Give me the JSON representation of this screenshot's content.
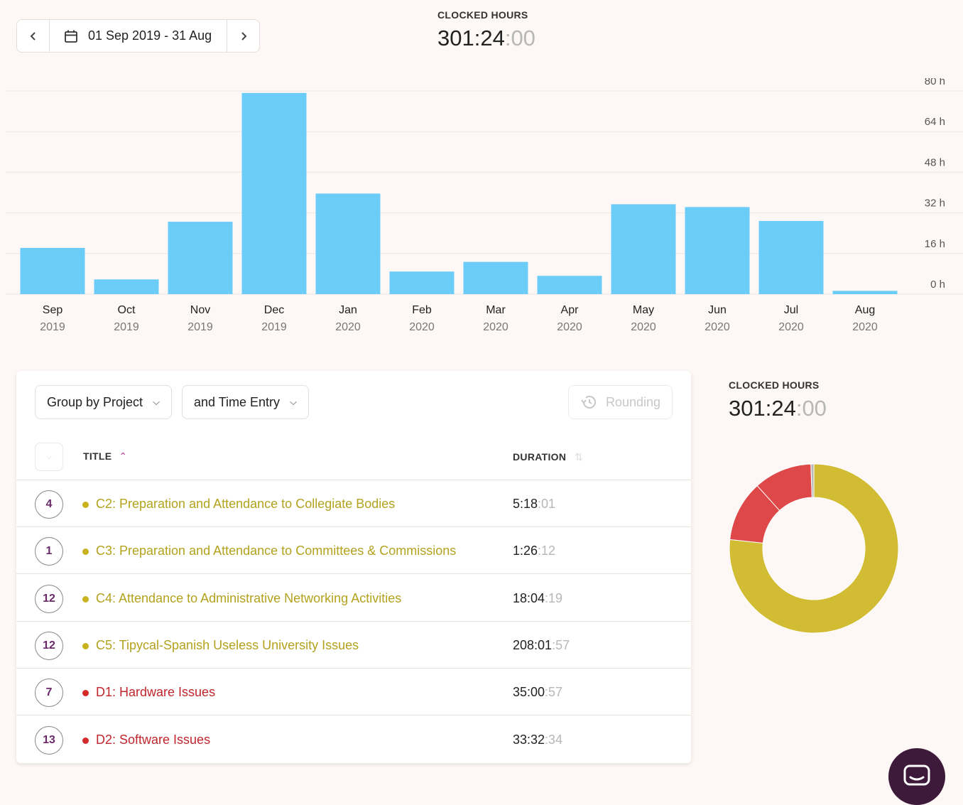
{
  "date_range": {
    "label": "01 Sep 2019 - 31 Aug",
    "prev_icon": "chevron-left-icon",
    "next_icon": "chevron-right-icon",
    "calendar_icon": "calendar-icon"
  },
  "top_summary": {
    "label": "CLOCKED HOURS",
    "time_main": "301:24",
    "time_sec": ":00"
  },
  "chart_data": {
    "type": "bar",
    "title": "",
    "xlabel": "",
    "ylabel": "",
    "categories": [
      "Sep 2019",
      "Oct 2019",
      "Nov 2019",
      "Dec 2019",
      "Jan 2020",
      "Feb 2020",
      "Mar 2020",
      "Apr 2020",
      "May 2020",
      "Jun 2020",
      "Jul 2020",
      "Aug 2020"
    ],
    "month_labels": [
      "Sep",
      "Oct",
      "Nov",
      "Dec",
      "Jan",
      "Feb",
      "Mar",
      "Apr",
      "May",
      "Jun",
      "Jul",
      "Aug"
    ],
    "year_labels": [
      "2019",
      "2019",
      "2019",
      "2019",
      "2020",
      "2020",
      "2020",
      "2020",
      "2020",
      "2020",
      "2020",
      "2020"
    ],
    "values": [
      18.2,
      5.8,
      28.5,
      79.2,
      39.6,
      8.9,
      12.7,
      7.2,
      35.4,
      34.3,
      28.8,
      1.3
    ],
    "ylim": [
      0,
      80
    ],
    "yticks": [
      0,
      16,
      32,
      48,
      64,
      80
    ],
    "ytick_labels": [
      "0 h",
      "16 h",
      "32 h",
      "48 h",
      "64 h",
      "80 h"
    ],
    "color": "#6cccf8",
    "grid": true,
    "y_axis_position": "right"
  },
  "controls": {
    "group_by_label": "Group by Project",
    "then_by_label": "and Time Entry",
    "rounding_label": "Rounding",
    "rounding_icon": "history-icon",
    "dropdown_icon": "chevron-down-icon"
  },
  "table": {
    "title_header": "TITLE",
    "duration_header": "DURATION",
    "sort_asc_icon": "sort-up-icon",
    "sort_icon": "sort-icon",
    "rows": [
      {
        "count": "4",
        "title": "C2: Preparation and Attendance to Collegiate Bodies",
        "dur_main": "5:18",
        "dur_sec": ":01",
        "color": "#b3a21e",
        "dot": "#c9b21f"
      },
      {
        "count": "1",
        "title": "C3: Preparation and Attendance to Committees & Commissions",
        "dur_main": "1:26",
        "dur_sec": ":12",
        "color": "#b3a21e",
        "dot": "#c9b21f"
      },
      {
        "count": "12",
        "title": "C4: Attendance to Administrative Networking Activities",
        "dur_main": "18:04",
        "dur_sec": ":19",
        "color": "#b3a21e",
        "dot": "#c9b21f"
      },
      {
        "count": "12",
        "title": "C5: Tipycal-Spanish Useless University Issues",
        "dur_main": "208:01",
        "dur_sec": ":57",
        "color": "#b3a21e",
        "dot": "#c9b21f"
      },
      {
        "count": "7",
        "title": "D1: Hardware Issues",
        "dur_main": "35:00",
        "dur_sec": ":57",
        "color": "#c0262d",
        "dot": "#d42a2a"
      },
      {
        "count": "13",
        "title": "D2: Software Issues",
        "dur_main": "33:32",
        "dur_sec": ":34",
        "color": "#c0262d",
        "dot": "#d42a2a"
      }
    ]
  },
  "side_summary": {
    "label": "CLOCKED HOURS",
    "time_main": "301:24",
    "time_sec": ":00"
  },
  "donut": {
    "segments": [
      {
        "value": 231.19,
        "color": "#d2bc33"
      },
      {
        "value": 35.02,
        "color": "#df4848"
      },
      {
        "value": 33.54,
        "color": "#df4848"
      },
      {
        "value": 1.69,
        "color": "#b8b8b8"
      }
    ]
  },
  "chat": {
    "icon": "chat-icon"
  }
}
